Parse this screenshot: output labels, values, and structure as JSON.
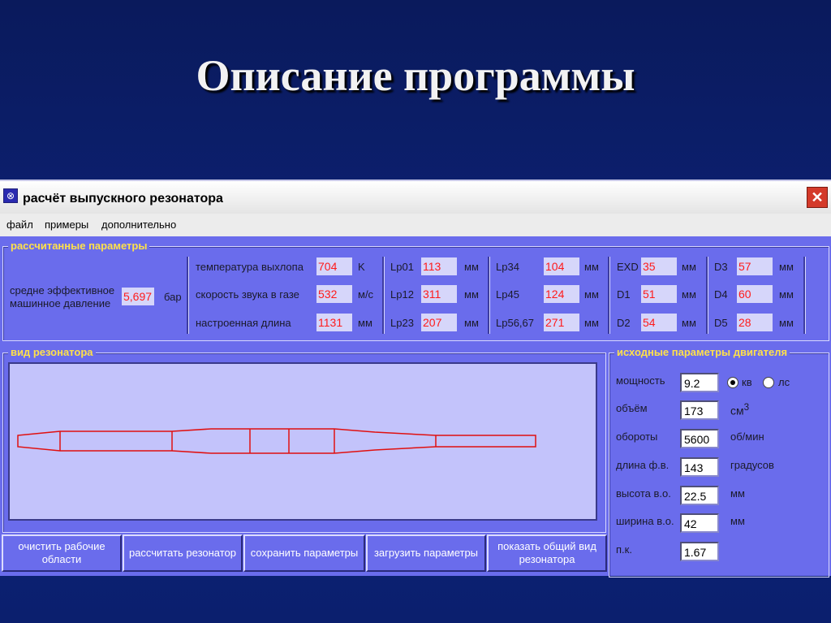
{
  "slide": {
    "title": "Описание программы"
  },
  "window": {
    "title": "расчёт выпускного резонатора",
    "close_glyph": "✕"
  },
  "menu": [
    {
      "label": "файл"
    },
    {
      "label": "примеры"
    },
    {
      "label": "дополнительно"
    }
  ],
  "calc": {
    "title": "рассчитанные параметры",
    "pressure": {
      "label": "средне эффективное машинное давление",
      "value": "5,697",
      "unit": "бар"
    },
    "temp": {
      "label": "температура выхлопа",
      "value": "704",
      "unit": "K"
    },
    "sound": {
      "label": "скорость звука в газе",
      "value": "532",
      "unit": "м/с"
    },
    "length": {
      "label": "настроенная длина",
      "value": "1131",
      "unit": "мм"
    },
    "params": [
      {
        "label": "Lp01",
        "value": "113",
        "unit": "мм"
      },
      {
        "label": "Lp12",
        "value": "311",
        "unit": "мм"
      },
      {
        "label": "Lp23",
        "value": "207",
        "unit": "мм"
      },
      {
        "label": "Lp34",
        "value": "104",
        "unit": "мм"
      },
      {
        "label": "Lp45",
        "value": "124",
        "unit": "мм"
      },
      {
        "label": "Lp56,67",
        "value": "271",
        "unit": "мм"
      },
      {
        "label": "EXD",
        "value": "35",
        "unit": "мм"
      },
      {
        "label": "D1",
        "value": "51",
        "unit": "мм"
      },
      {
        "label": "D2",
        "value": "54",
        "unit": "мм"
      },
      {
        "label": "D3",
        "value": "57",
        "unit": "мм"
      },
      {
        "label": "D4",
        "value": "60",
        "unit": "мм"
      },
      {
        "label": "D5",
        "value": "28",
        "unit": "мм"
      }
    ]
  },
  "view": {
    "title": "вид резонатора",
    "line_color": "#e01010"
  },
  "engine": {
    "title": "исходные параметры двигателя",
    "power": {
      "label": "мощность",
      "value": "9.2",
      "opt1": "кв",
      "opt2": "лс",
      "selected": "кв"
    },
    "volume": {
      "label": "объём",
      "value": "173",
      "unit": "см",
      "unit_sup": "3"
    },
    "rpm": {
      "label": "обороты",
      "value": "5600",
      "unit": "об/мин"
    },
    "duration": {
      "label": "длина ф.в.",
      "value": "143",
      "unit": "градусов"
    },
    "height": {
      "label": "высота в.о.",
      "value": "22.5",
      "unit": "мм"
    },
    "width": {
      "label": "ширина в.о.",
      "value": "42",
      "unit": "мм"
    },
    "pk": {
      "label": "п.к.",
      "value": "1.67"
    }
  },
  "buttons": {
    "clear": "очистить рабочие области",
    "calculate": "рассчитать резонатор",
    "save": "сохранить параметры",
    "load": "загрузить параметры",
    "show": "показать общий вид резонатора"
  },
  "colors": {
    "window_bg": "#6a6cec",
    "label_yellow": "#ffe14a",
    "value_red": "#ff1a1a"
  }
}
